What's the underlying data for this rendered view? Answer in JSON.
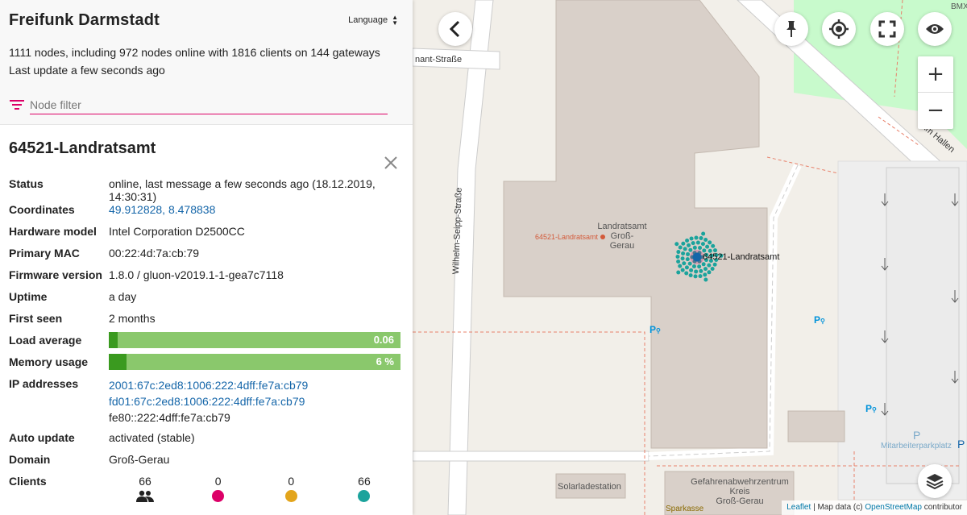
{
  "app": {
    "title": "Freifunk Darmstadt",
    "language_label": "Language",
    "stats_line": "1111 nodes, including 972 nodes online with 1816 clients on 144 gateways",
    "last_update": "Last update a few seconds ago",
    "filter_placeholder": "Node filter"
  },
  "node": {
    "name": "64521-Landratsamt",
    "rows": {
      "status_label": "Status",
      "status_value": "online, last message a few seconds ago (18.12.2019, 14:30:31)",
      "coordinates_label": "Coordinates",
      "coordinates_value": "49.912828, 8.478838",
      "hardware_label": "Hardware model",
      "hardware_value": "Intel Corporation D2500CC",
      "mac_label": "Primary MAC",
      "mac_value": "00:22:4d:7a:cb:79",
      "firmware_label": "Firmware version",
      "firmware_value": "1.8.0 / gluon-v2019.1-1-gea7c7118",
      "uptime_label": "Uptime",
      "uptime_value": "a day",
      "first_seen_label": "First seen",
      "first_seen_value": "2 months",
      "load_label": "Load average",
      "load_value": "0.06",
      "load_fraction": 0.03,
      "memory_label": "Memory usage",
      "memory_value": "6 %",
      "memory_fraction": 0.06,
      "ip_label": "IP addresses",
      "ip_1": "2001:67c:2ed8:1006:222:4dff:fe7a:cb79",
      "ip_2": "fd01:67c:2ed8:1006:222:4dff:fe7a:cb79",
      "ip_3": "fe80::222:4dff:fe7a:cb79",
      "autoupdate_label": "Auto update",
      "autoupdate_value": "activated (stable)",
      "domain_label": "Domain",
      "domain_value": "Groß-Gerau",
      "clients_label": "Clients"
    },
    "clients": {
      "total": "66",
      "c1": "0",
      "c2": "0",
      "c3": "66",
      "colors": {
        "c1": "#dc0067",
        "c2": "#e3a51c",
        "c3": "#1ba39c"
      }
    }
  },
  "map": {
    "node_label": "64521-Landratsamt",
    "node_label_small": "64521-Landratsamt",
    "building_label_1": "Landratsamt",
    "building_label_2": "Groß-",
    "building_label_3": "Gerau",
    "street_1": "nant-Straße",
    "street_2": "Wilhelm-Seipp-Straße",
    "street_3": "Am Hallen",
    "street_4": "Heinr-Dunant-Straße",
    "bmx": "BMX",
    "solar": "Solarladestation",
    "fire_1": "Gefahrenabwehrzentrum",
    "fire_2": "Kreis",
    "fire_3": "Groß-Gerau",
    "bank": "Sparkasse",
    "parking_label": "Mitarbeiterparkplatz",
    "parking_symbol": "P",
    "attr_leaflet": "Leaflet",
    "attr_mid": "| Map data (c)",
    "attr_osm": "OpenStreetMap",
    "attr_end": "contributor",
    "zoom_in": "+",
    "zoom_out": "−",
    "accent_color": "#dc0067",
    "node_color": "#1566a9"
  }
}
